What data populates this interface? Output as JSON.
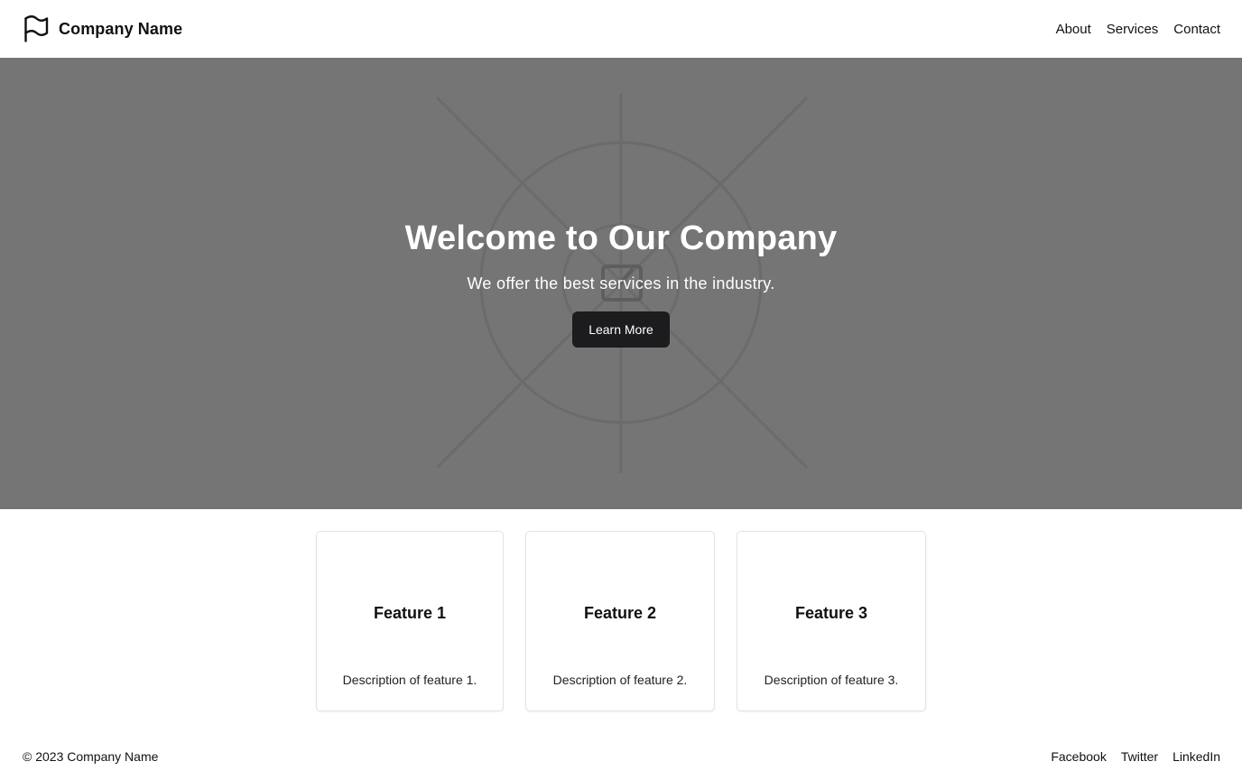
{
  "header": {
    "brand_icon": "flag-icon",
    "brand_name": "Company Name",
    "nav": [
      {
        "label": "About"
      },
      {
        "label": "Services"
      },
      {
        "label": "Contact"
      }
    ]
  },
  "hero": {
    "background_color": "#757575",
    "illustration": "placeholder-image-icon",
    "title": "Welcome to Our Company",
    "subtitle": "We offer the best services in the industry.",
    "button_label": "Learn More"
  },
  "features": [
    {
      "title": "Feature 1",
      "description": "Description of feature 1."
    },
    {
      "title": "Feature 2",
      "description": "Description of feature 2."
    },
    {
      "title": "Feature 3",
      "description": "Description of feature 3."
    }
  ],
  "footer": {
    "copyright": "© 2023 Company Name",
    "social": [
      {
        "label": "Facebook"
      },
      {
        "label": "Twitter"
      },
      {
        "label": "LinkedIn"
      }
    ]
  }
}
